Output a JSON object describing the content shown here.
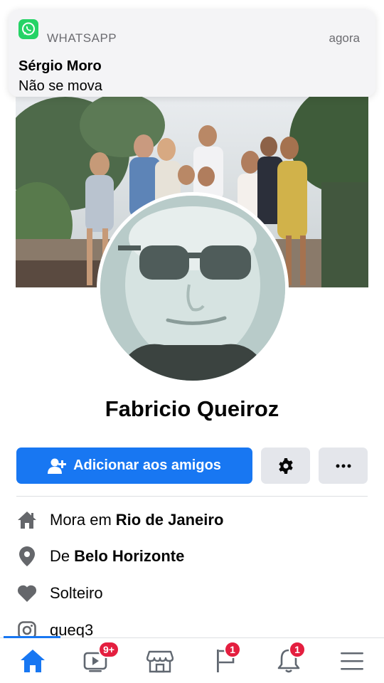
{
  "notification": {
    "app_name": "WHATSAPP",
    "time": "agora",
    "title": "Sérgio Moro",
    "message": "Não se mova",
    "icon": "whatsapp-icon",
    "accent_color": "#25d366"
  },
  "profile": {
    "name": "Fabricio Queiroz"
  },
  "actions": {
    "add_friend_label": "Adicionar aos amigos",
    "add_friend_icon": "add-friend-icon",
    "settings_icon": "gear-icon",
    "more_icon": "more-icon"
  },
  "info": {
    "lives_in_prefix": "Mora em",
    "lives_in_place": "Rio de Janeiro",
    "from_prefix": "De",
    "from_place": "Belo Horizonte",
    "relationship": "Solteiro",
    "instagram": "queq3"
  },
  "nav": {
    "items": [
      {
        "icon": "home-icon",
        "active": true
      },
      {
        "icon": "watch-icon",
        "badge": "9+"
      },
      {
        "icon": "marketplace-icon"
      },
      {
        "icon": "pages-flag-icon",
        "badge": "1"
      },
      {
        "icon": "bell-icon",
        "badge": "1"
      },
      {
        "icon": "menu-icon"
      }
    ]
  },
  "colors": {
    "primary": "#1877f2",
    "badge": "#e41e3f",
    "secondary_button": "#e4e6eb"
  }
}
